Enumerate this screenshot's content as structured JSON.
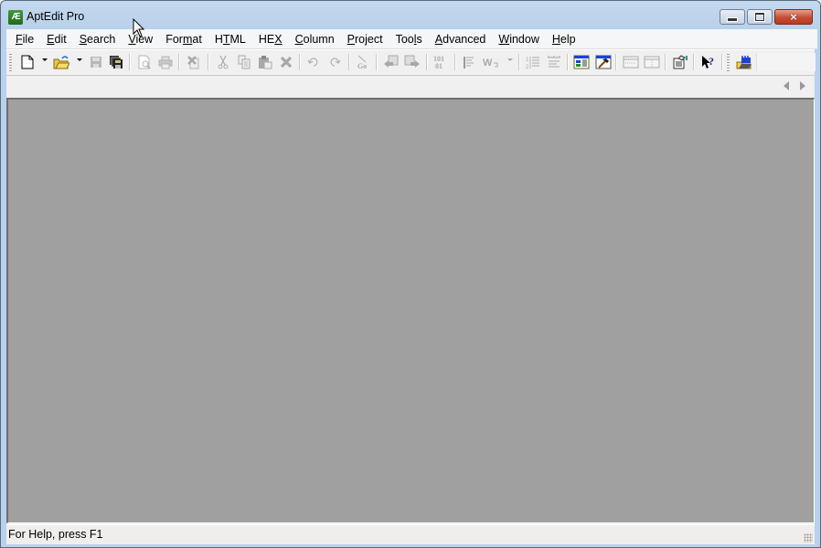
{
  "window": {
    "title": "AptEdit Pro",
    "app_icon_text": "Æ",
    "controls": {
      "minimize": "minimize",
      "maximize": "maximize",
      "close": "×"
    }
  },
  "menubar": {
    "items": [
      {
        "label": "File",
        "accel": "F"
      },
      {
        "label": "Edit",
        "accel": "E"
      },
      {
        "label": "Search",
        "accel": "S"
      },
      {
        "label": "View",
        "accel": "V"
      },
      {
        "label": "Format",
        "accel": "m"
      },
      {
        "label": "HTML",
        "accel": "T"
      },
      {
        "label": "HEX",
        "accel": "X"
      },
      {
        "label": "Column",
        "accel": "C"
      },
      {
        "label": "Project",
        "accel": "P"
      },
      {
        "label": "Tools",
        "accel": "l"
      },
      {
        "label": "Advanced",
        "accel": "A"
      },
      {
        "label": "Window",
        "accel": "W"
      },
      {
        "label": "Help",
        "accel": "H"
      }
    ]
  },
  "toolbar": {
    "buttons": [
      {
        "name": "new-file",
        "icon": "new-document-icon",
        "enabled": true,
        "dropdown": true
      },
      {
        "name": "open-file",
        "icon": "open-folder-icon",
        "enabled": true,
        "dropdown": true
      },
      {
        "name": "save",
        "icon": "save-disk-icon",
        "enabled": false
      },
      {
        "name": "save-all",
        "icon": "save-all-icon",
        "enabled": true
      },
      {
        "name": "print-preview",
        "icon": "print-preview-icon",
        "enabled": false
      },
      {
        "name": "print",
        "icon": "printer-icon",
        "enabled": false
      },
      {
        "name": "close-file",
        "icon": "close-document-icon",
        "enabled": false
      },
      {
        "name": "cut",
        "icon": "scissors-icon",
        "enabled": false
      },
      {
        "name": "copy",
        "icon": "copy-icon",
        "enabled": false
      },
      {
        "name": "paste",
        "icon": "paste-icon",
        "enabled": false
      },
      {
        "name": "delete",
        "icon": "delete-x-icon",
        "enabled": false
      },
      {
        "name": "undo",
        "icon": "undo-icon",
        "enabled": false
      },
      {
        "name": "redo",
        "icon": "redo-icon",
        "enabled": false
      },
      {
        "name": "go-to",
        "icon": "goto-icon",
        "enabled": false,
        "text": "Go"
      },
      {
        "name": "previous-bookmark",
        "icon": "prev-bookmark-icon",
        "enabled": false
      },
      {
        "name": "next-bookmark",
        "icon": "next-bookmark-icon",
        "enabled": false
      },
      {
        "name": "hex-mode",
        "icon": "binary-icon",
        "enabled": false,
        "text": "101\n01"
      },
      {
        "name": "align",
        "icon": "align-icon",
        "enabled": false
      },
      {
        "name": "word-wrap",
        "icon": "word-wrap-icon",
        "enabled": false,
        "dropdown": true
      },
      {
        "name": "line-numbers",
        "icon": "line-numbers-icon",
        "enabled": false
      },
      {
        "name": "ruler",
        "icon": "ruler-icon",
        "enabled": false
      },
      {
        "name": "project-window",
        "icon": "project-panel-icon",
        "enabled": true
      },
      {
        "name": "tools",
        "icon": "hammer-icon",
        "enabled": true
      },
      {
        "name": "split-horizontal",
        "icon": "split-horizontal-icon",
        "enabled": false
      },
      {
        "name": "split-vertical",
        "icon": "split-vertical-icon",
        "enabled": false
      },
      {
        "name": "properties",
        "icon": "properties-icon",
        "enabled": true
      },
      {
        "name": "context-help",
        "icon": "help-pointer-icon",
        "enabled": true
      },
      {
        "name": "ftp-open",
        "icon": "ftp-folder-icon",
        "enabled": true
      }
    ]
  },
  "tabbar": {
    "scroll_left": "scroll-tabs-left",
    "scroll_right": "scroll-tabs-right"
  },
  "statusbar": {
    "text": "For Help, press F1"
  },
  "colors": {
    "mdi_background": "#a0a0a0",
    "title_bar": "#b9d1ea",
    "close_button": "#c44c34"
  }
}
